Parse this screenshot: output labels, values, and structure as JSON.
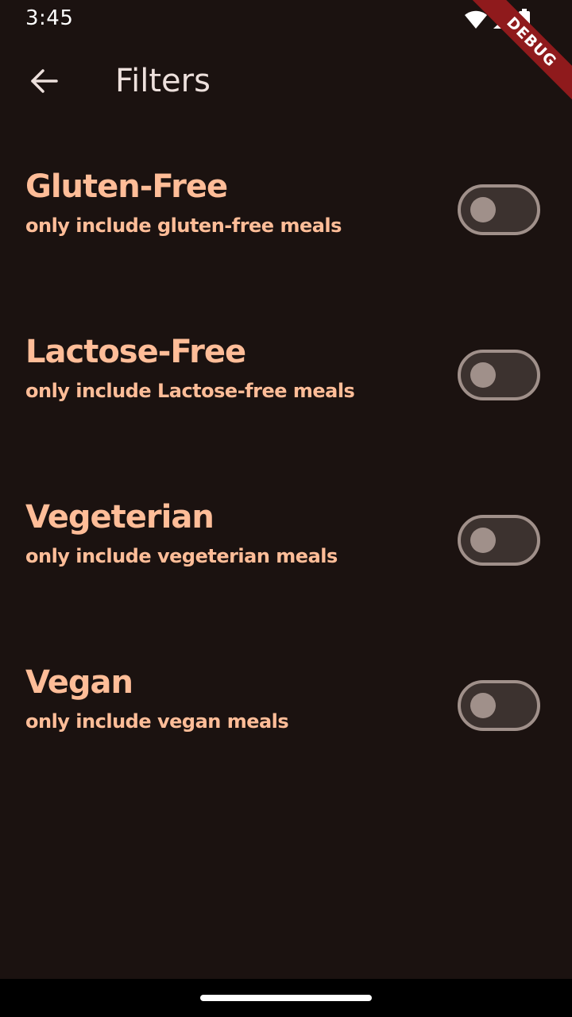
{
  "status_bar": {
    "time": "3:45",
    "icons": [
      "wifi-icon",
      "cellular-signal-icon",
      "battery-icon"
    ]
  },
  "debug_banner": {
    "label": "DEBUG"
  },
  "app_bar": {
    "back_icon": "arrow-back-icon",
    "title": "Filters"
  },
  "filters": [
    {
      "title": "Gluten-Free",
      "subtitle": "only include gluten-free meals",
      "enabled": false
    },
    {
      "title": "Lactose-Free",
      "subtitle": "only include Lactose-free meals",
      "enabled": false
    },
    {
      "title": "Vegeterian",
      "subtitle": "only include vegeterian meals",
      "enabled": false
    },
    {
      "title": "Vegan",
      "subtitle": "only include vegan meals",
      "enabled": false
    }
  ],
  "colors": {
    "background": "#1b1210",
    "accent_text": "#ffbd98",
    "title_text": "#ede0dc",
    "switch_outline": "#a0908a",
    "switch_track": "#3c322f",
    "debug_banner": "#8f1a1c"
  }
}
